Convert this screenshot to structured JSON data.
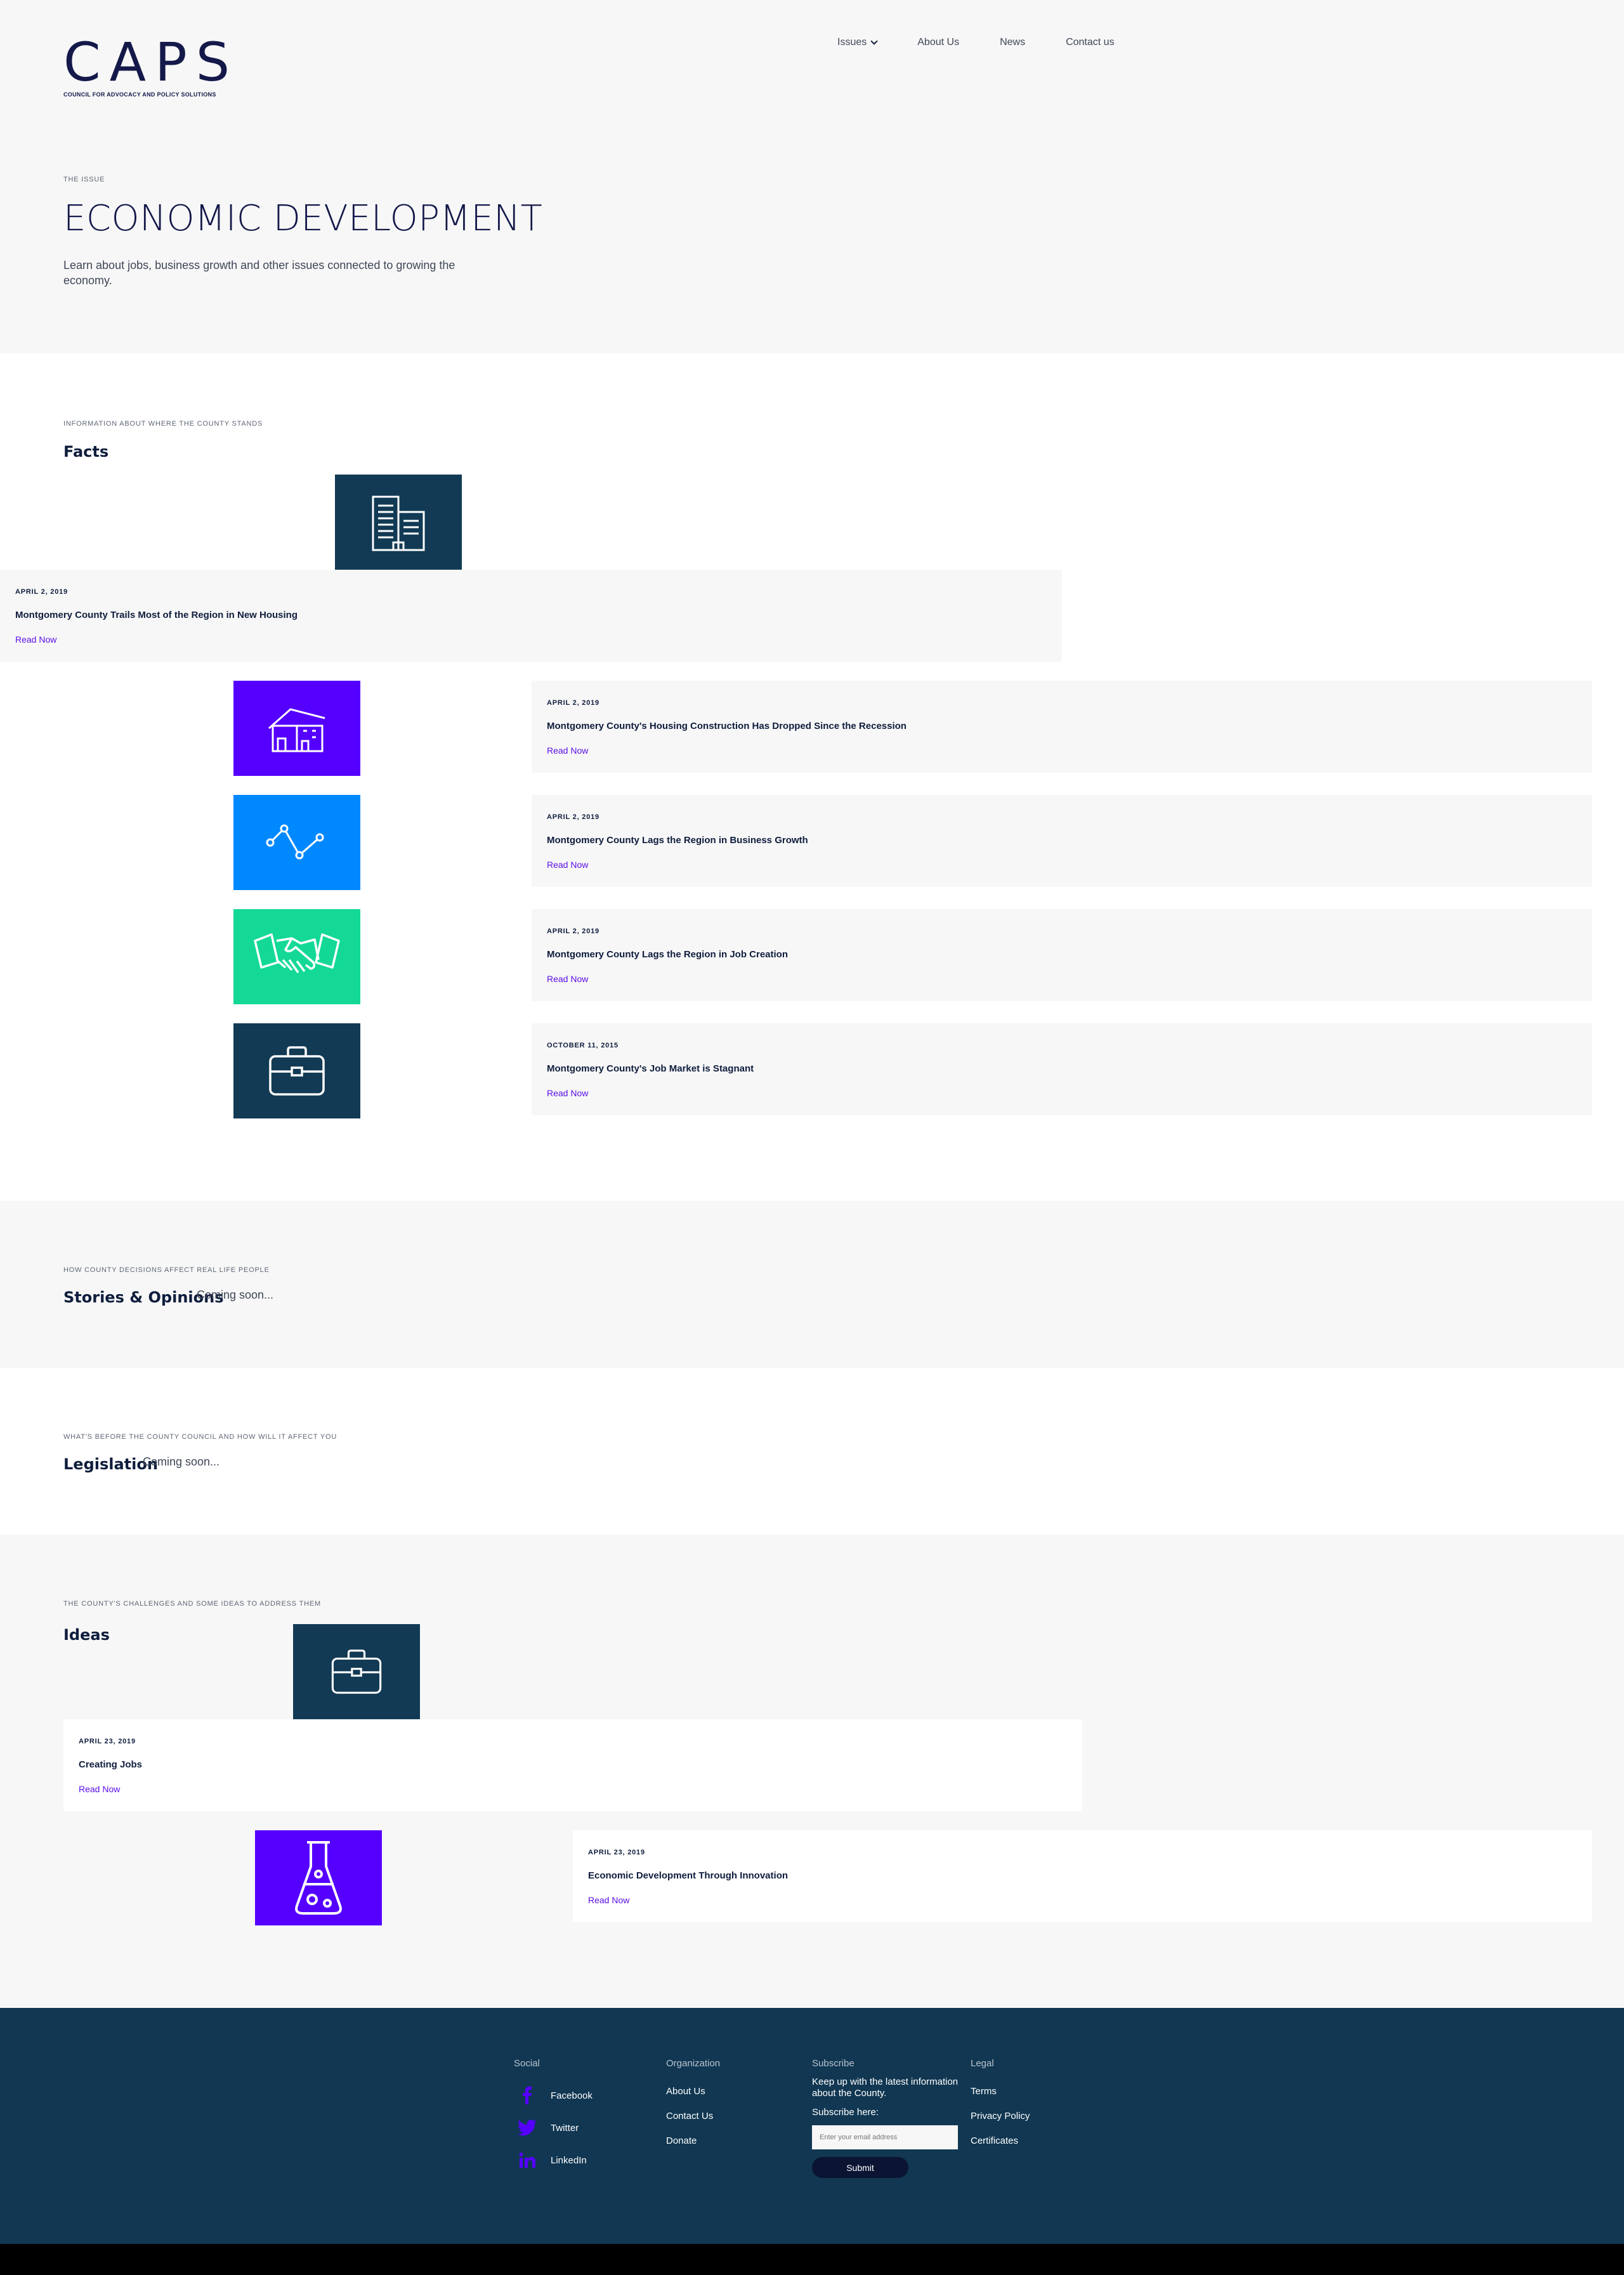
{
  "brand": {
    "logo_text": "CAPS",
    "logo_subtitle": "COUNCIL FOR ADVOCACY AND POLICY SOLUTIONS"
  },
  "nav": {
    "items": [
      "Issues",
      "About Us",
      "News",
      "Contact us"
    ]
  },
  "hero": {
    "eyebrow": "THE ISSUE",
    "title": "ECONOMIC DEVELOPMENT",
    "description": "Learn about jobs, business growth and other issues connected to growing the economy."
  },
  "facts": {
    "eyebrow": "INFORMATION ABOUT WHERE THE COUNTY STANDS",
    "title": "Facts",
    "cards": [
      {
        "date": "APRIL 2, 2019",
        "title": "Montgomery County Trails Most of the Region in New Housing",
        "cta": "Read Now",
        "icon": "office-building-icon",
        "color": "#123a54"
      },
      {
        "date": "APRIL 2, 2019",
        "title": "Montgomery County's Housing Construction Has Dropped Since the Recession",
        "cta": "Read Now",
        "icon": "house-icon",
        "color": "#5500ff"
      },
      {
        "date": "APRIL 2, 2019",
        "title": "Montgomery County Lags the Region in Business Growth",
        "cta": "Read Now",
        "icon": "line-chart-icon",
        "color": "#0088ff"
      },
      {
        "date": "APRIL 2, 2019",
        "title": "Montgomery County Lags the Region in Job Creation",
        "cta": "Read Now",
        "icon": "handshake-icon",
        "color": "#14d996"
      },
      {
        "date": "OCTOBER 11, 2015",
        "title": "Montgomery County's Job Market is Stagnant",
        "cta": "Read Now",
        "icon": "briefcase-icon",
        "color": "#123a54"
      }
    ]
  },
  "stories": {
    "eyebrow": "HOW COUNTY DECISIONS AFFECT REAL LIFE PEOPLE",
    "title": "Stories & Opinions",
    "placeholder": "Coming soon..."
  },
  "legislation": {
    "eyebrow": "WHAT'S BEFORE THE COUNTY COUNCIL AND HOW WILL IT AFFECT YOU",
    "title": "Legislation",
    "placeholder": "Coming soon..."
  },
  "ideas": {
    "eyebrow": "THE COUNTY'S CHALLENGES AND SOME IDEAS TO ADDRESS THEM",
    "title": "Ideas",
    "cards": [
      {
        "date": "APRIL 23, 2019",
        "title": "Creating Jobs",
        "cta": "Read Now",
        "icon": "briefcase-icon",
        "color": "#123a54"
      },
      {
        "date": "APRIL 23, 2019",
        "title": "Economic Development Through Innovation",
        "cta": "Read Now",
        "icon": "flask-icon",
        "color": "#5500ff"
      }
    ]
  },
  "footer": {
    "social": {
      "heading": "Social",
      "items": [
        "Facebook",
        "Twitter",
        "LinkedIn"
      ],
      "icon_color": "#5500ff"
    },
    "organization": {
      "heading": "Organization",
      "items": [
        "About Us",
        "Contact Us",
        "Donate"
      ]
    },
    "subscribe": {
      "heading": "Subscribe",
      "text": "Keep up with the latest information about the County.",
      "label": "Subscribe here:",
      "placeholder": "Enter your email address",
      "button": "Submit"
    },
    "legal": {
      "heading": "Legal",
      "items": [
        "Terms",
        "Privacy Policy",
        "Certificates"
      ]
    }
  }
}
